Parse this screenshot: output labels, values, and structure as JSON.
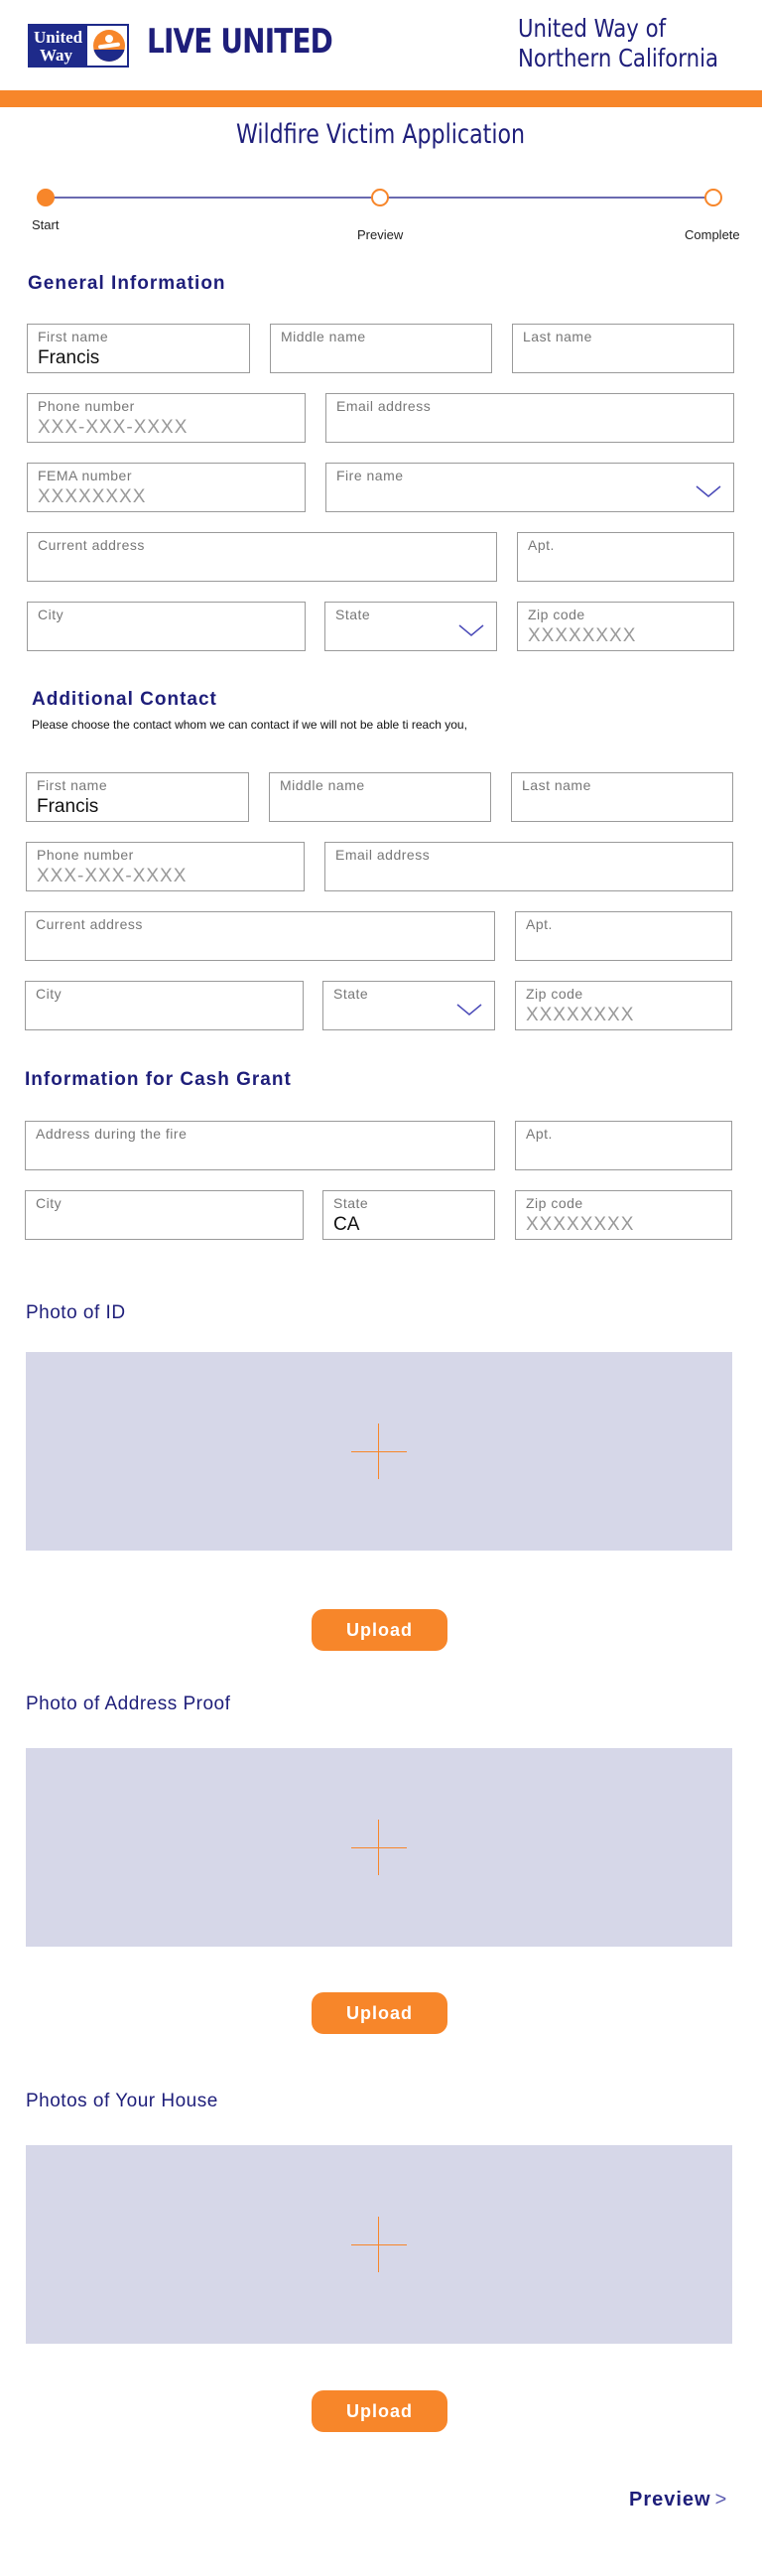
{
  "header": {
    "logo_line1": "United",
    "logo_line2": "Way",
    "tagline": "LIVE UNITED",
    "org_line1": "United Way of",
    "org_line2": "Northern California"
  },
  "colors": {
    "brand_blue": "#1e1e7a",
    "accent_orange": "#f7862a",
    "photo_bg": "#d6d7e8"
  },
  "page_title": "Wildfire Victim Application",
  "stepper": {
    "steps": [
      "Start",
      "Preview",
      "Complete"
    ],
    "current": "Start"
  },
  "general": {
    "title": "General Information",
    "first_name": {
      "label": "First name",
      "value": "Francis"
    },
    "middle_name": {
      "label": "Middle name"
    },
    "last_name": {
      "label": "Last name"
    },
    "phone": {
      "label": "Phone number",
      "placeholder": "XXX-XXX-XXXX"
    },
    "email": {
      "label": "Email address"
    },
    "fema": {
      "label": "FEMA number",
      "placeholder": "XXXXXXXX"
    },
    "fire": {
      "label": "Fire name"
    },
    "address": {
      "label": "Current address"
    },
    "apt": {
      "label": "Apt."
    },
    "city": {
      "label": "City"
    },
    "state": {
      "label": "State"
    },
    "zip": {
      "label": "Zip code",
      "placeholder": "XXXXXXXX"
    }
  },
  "additional": {
    "title": "Additional Contact",
    "note": "Please choose the contact whom we can contact if we will not be able ti reach you,",
    "first_name": {
      "label": "First name",
      "value": "Francis"
    },
    "middle_name": {
      "label": "Middle name"
    },
    "last_name": {
      "label": "Last name"
    },
    "phone": {
      "label": "Phone number",
      "placeholder": "XXX-XXX-XXXX"
    },
    "email": {
      "label": "Email address"
    },
    "address": {
      "label": "Current address"
    },
    "apt": {
      "label": "Apt."
    },
    "city": {
      "label": "City"
    },
    "state": {
      "label": "State"
    },
    "zip": {
      "label": "Zip code",
      "placeholder": "XXXXXXXX"
    }
  },
  "cash": {
    "title": "Information for Cash Grant",
    "address": {
      "label": "Address during the fire"
    },
    "apt": {
      "label": "Apt."
    },
    "city": {
      "label": "City"
    },
    "state": {
      "label": "State",
      "value": "CA"
    },
    "zip": {
      "label": "Zip code",
      "placeholder": "XXXXXXXX"
    }
  },
  "photos": [
    {
      "title": "Photo of ID",
      "button": "Upload"
    },
    {
      "title": "Photo of Address Proof",
      "button": "Upload"
    },
    {
      "title": "Photos of Your House",
      "button": "Upload"
    }
  ],
  "footer": {
    "preview_label": "Preview",
    "preview_arrow": ">"
  }
}
